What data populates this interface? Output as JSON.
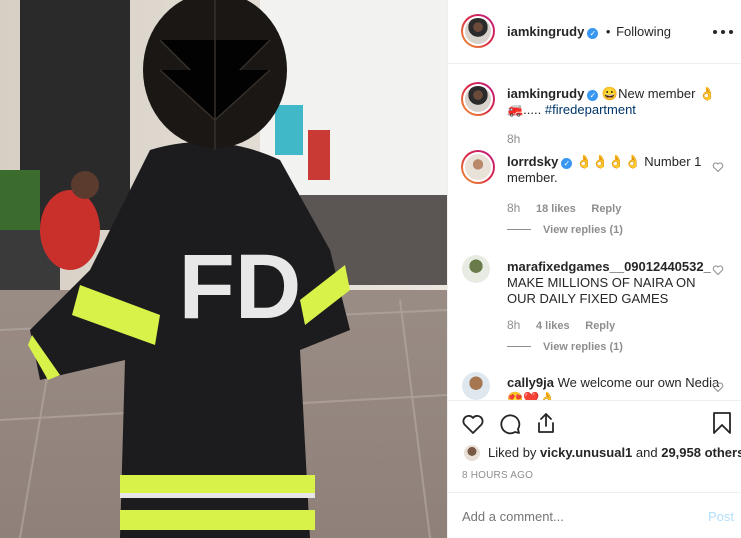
{
  "post": {
    "author": "iamkingrudy",
    "follow_sep": "•",
    "follow_status": "Following",
    "more_icon": "more-horizontal-icon"
  },
  "caption": {
    "username": "iamkingrudy",
    "text": "😀New member 👌",
    "line2": "🚒..... ",
    "hashtag": "#firedepartment",
    "time": "8h"
  },
  "comments": [
    {
      "username": "lorrdsky",
      "verified": true,
      "text": "👌👌👌👌 Number 1 member.",
      "time": "8h",
      "likes": "18 likes",
      "reply": "Reply",
      "view_replies": "View replies (1)"
    },
    {
      "username": "marafixedgames__09012440532_",
      "verified": false,
      "text": "MAKE MILLIONS OF NAIRA ON OUR DAILY FIXED GAMES",
      "time": "8h",
      "likes": "4 likes",
      "reply": "Reply",
      "view_replies": "View replies (1)"
    },
    {
      "username": "cally9ja",
      "verified": false,
      "text": "We welcome our own Nedia 😍❤️👌"
    }
  ],
  "likes": {
    "prefix": "Liked by ",
    "user": "vicky.unusual1",
    "middle": " and ",
    "others": "29,958 others"
  },
  "timestamp": "8 HOURS AGO",
  "add_comment": {
    "placeholder": "Add a comment...",
    "post_label": "Post"
  },
  "photo": {
    "jacket_text": "FD"
  },
  "colors": {
    "link": "#003569",
    "verified": "#3897f0",
    "post_disabled": "#b2dffc",
    "muted": "#8e8e8e",
    "jacket": "#1c1c1e",
    "reflective": "#d9f24a"
  }
}
